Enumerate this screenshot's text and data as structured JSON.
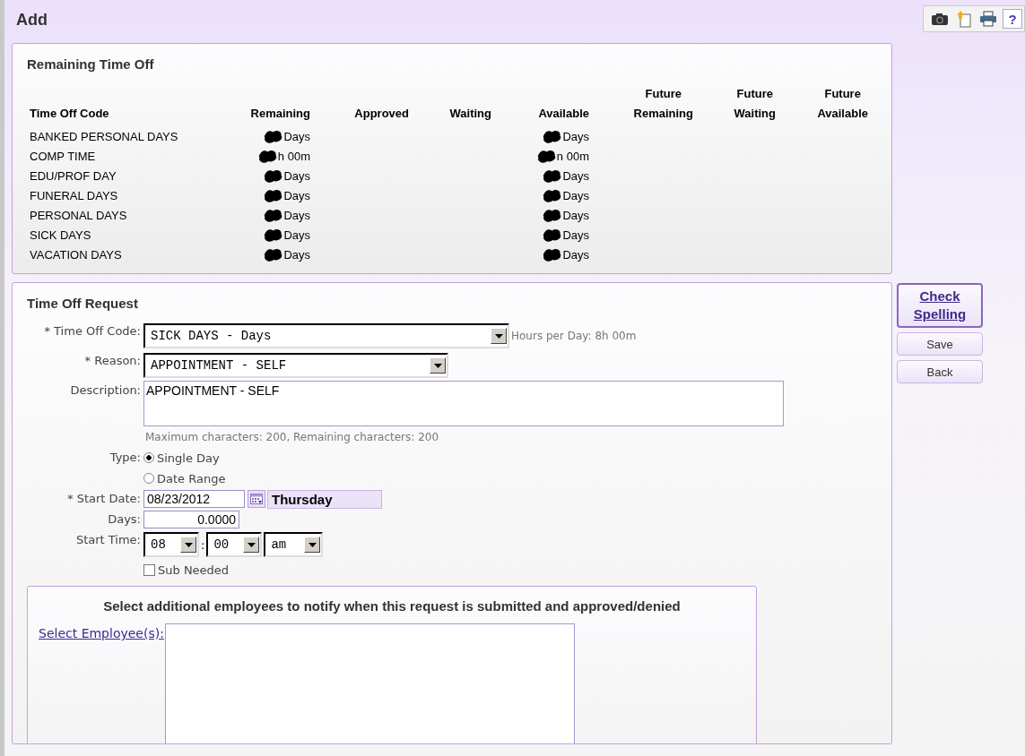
{
  "header": {
    "title": "Add"
  },
  "toolbar": [
    {
      "kind": "camera"
    },
    {
      "kind": "note"
    },
    {
      "kind": "printer"
    },
    {
      "kind": "help",
      "label": "?"
    }
  ],
  "balances": {
    "title": "Remaining Time Off",
    "columns": [
      "Time Off Code",
      "Remaining",
      "Approved",
      "Waiting",
      "Available",
      "Future Remaining",
      "Future Waiting",
      "Future Available"
    ],
    "rows": [
      {
        "code": "BANKED PERSONAL DAYS",
        "remaining": {
          "text": "Days",
          "redacted": true
        },
        "available": {
          "text": "Days",
          "redacted": true
        }
      },
      {
        "code": "COMP TIME",
        "remaining": {
          "text": "h 00m",
          "redacted": true
        },
        "available": {
          "text": "n 00m",
          "redacted": true
        }
      },
      {
        "code": "EDU/PROF DAY",
        "remaining": {
          "text": "Days",
          "redacted": true
        },
        "available": {
          "text": "Days",
          "redacted": true
        }
      },
      {
        "code": "FUNERAL DAYS",
        "remaining": {
          "text": "Days",
          "redacted": true
        },
        "available": {
          "text": "Days",
          "redacted": true
        }
      },
      {
        "code": "PERSONAL DAYS",
        "remaining": {
          "text": "Days",
          "redacted": true
        },
        "available": {
          "text": "Days",
          "redacted": true
        }
      },
      {
        "code": "SICK DAYS",
        "remaining": {
          "text": "Days",
          "redacted": true
        },
        "available": {
          "text": "Days",
          "redacted": true
        }
      },
      {
        "code": "VACATION DAYS",
        "remaining": {
          "text": "Days",
          "redacted": true
        },
        "available": {
          "text": "Days",
          "redacted": true
        }
      }
    ]
  },
  "request": {
    "title": "Time Off Request",
    "time_off_code": {
      "label": "* Time Off Code:",
      "value": "SICK DAYS - Days",
      "note": "Hours per Day: 8h 00m"
    },
    "reason": {
      "label": "* Reason:",
      "value": "APPOINTMENT - SELF"
    },
    "description": {
      "label": "Description:",
      "value": "APPOINTMENT - SELF",
      "hint": "Maximum characters: 200, Remaining characters: 200"
    },
    "type": {
      "label": "Type:",
      "options": [
        {
          "label": "Single Day",
          "selected": true
        },
        {
          "label": "Date Range",
          "selected": false
        }
      ]
    },
    "start_date": {
      "label": "* Start Date:",
      "value": "08/23/2012",
      "weekday": "Thursday"
    },
    "days": {
      "label": "Days:",
      "value": "0.0000"
    },
    "start_time": {
      "label": "Start Time:",
      "hour": "08",
      "separator": ":",
      "minute": "00",
      "meridiem": "am"
    },
    "sub_needed": {
      "label": "Sub Needed",
      "checked": false
    },
    "notify": {
      "title": "Select additional employees to notify when this request is submitted and approved/denied",
      "link": "Select Employee(s):"
    }
  },
  "buttons": [
    {
      "label": "Check Spelling",
      "kind": "primary"
    },
    {
      "label": "Save",
      "kind": "plain"
    },
    {
      "label": "Back",
      "kind": "plain"
    }
  ]
}
